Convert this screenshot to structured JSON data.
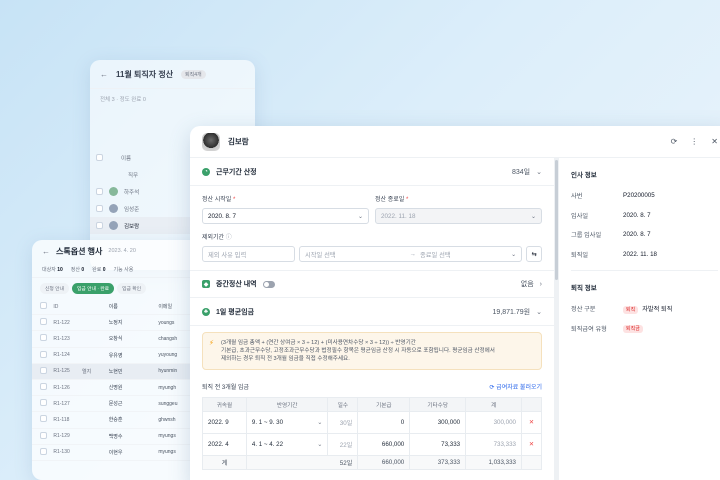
{
  "bg_panel_1": {
    "title": "11월 퇴직자 정산",
    "badge": "퇴직4개",
    "subtitle": "전체 3 · 정도 완료 0",
    "col_name": "이름",
    "col_role": "직무",
    "rows": [
      {
        "name": "하주석"
      },
      {
        "name": "임성준"
      },
      {
        "name": "김보람"
      }
    ]
  },
  "bg_panel_2": {
    "title": "스톡옵션 행사",
    "date": "2023. 4. 20",
    "stats": [
      {
        "label": "대상자",
        "value": "10"
      },
      {
        "label": "정산",
        "value": "0"
      },
      {
        "label": "완료",
        "value": "0"
      },
      {
        "label": "기능 사용",
        "value": ""
      }
    ],
    "chips": [
      "신청 안내",
      "입금 안내 · 완료",
      "입금 확인"
    ],
    "headers": [
      "ID",
      "이름",
      "이메일"
    ],
    "rows": [
      {
        "id": "R1-122",
        "tag": "",
        "name": "노정지",
        "email": "youngs"
      },
      {
        "id": "R1-123",
        "tag": "",
        "name": "오창식",
        "email": "changsh"
      },
      {
        "id": "R1-124",
        "tag": "",
        "name": "유유영",
        "email": "yuyoung"
      },
      {
        "id": "R1-125",
        "tag": "엘지",
        "name": "노현민",
        "email": "hyunmin"
      },
      {
        "id": "R1-126",
        "tag": "",
        "name": "신명원",
        "email": "myungh"
      },
      {
        "id": "R1-127",
        "tag": "",
        "name": "문성근",
        "email": "sunggeu"
      },
      {
        "id": "R1-118",
        "tag": "",
        "name": "한승훈",
        "email": "ghwnsh"
      },
      {
        "id": "R1-129",
        "tag": "",
        "name": "백명수",
        "email": "myungs"
      },
      {
        "id": "R1-130",
        "tag": "",
        "name": "이현우",
        "email": "myungs"
      }
    ]
  },
  "main": {
    "employee_name": "김보람",
    "service": {
      "title": "근무기간 산정",
      "value": "834일",
      "start_label": "정산 시작일",
      "start_value": "2020. 8. 7",
      "end_label": "정산 종료일",
      "end_value": "2022. 11. 18",
      "exclude_label": "제외기간",
      "reason_placeholder": "제외 사유 입력",
      "start_placeholder": "시작일 선택",
      "end_placeholder": "종료일 선택"
    },
    "interim": {
      "title": "중간정산 내역",
      "value": "없음"
    },
    "avg": {
      "title": "1일 평균임금",
      "value": "19,871.79원",
      "note_line1": "(3개월 임금 총액 + (연간 상여금 × 3 ÷ 12) + (미사용연차수당 × 3 ÷ 12)) ÷ 반영기간",
      "note_line2": "기본급, 초과근무수당, 고정조과근무수당과 법정필수 항목은 평균임금 산정 시 자동으로 포함됩니다. 평균임금 산정에서",
      "note_line3": "제외하는 경우 퇴직 전 3개월 임금을 직접 수정해주세요."
    },
    "wage": {
      "title": "퇴직 전 3개월 임금",
      "load_link": "급여자료 불러오기",
      "headers": [
        "귀속월",
        "반영기간",
        "일수",
        "기본급",
        "기타수당",
        "계"
      ],
      "rows": [
        {
          "month": "2022. 9",
          "period": "9. 1 ~ 9. 30",
          "days": "30일",
          "base": "0",
          "other": "300,000",
          "total": "300,000"
        },
        {
          "month": "2022. 4",
          "period": "4. 1 ~ 4. 22",
          "days": "22일",
          "base": "660,000",
          "other": "73,333",
          "total": "733,333"
        }
      ],
      "sum": {
        "label": "계",
        "days": "52일",
        "base": "660,000",
        "other": "373,333",
        "total": "1,033,333"
      }
    }
  },
  "right": {
    "hr_title": "인사 정보",
    "hr": [
      {
        "k": "사번",
        "v": "P20200005"
      },
      {
        "k": "입사일",
        "v": "2020. 8. 7"
      },
      {
        "k": "그룹 입사일",
        "v": "2020. 8. 7"
      },
      {
        "k": "퇴직일",
        "v": "2022. 11. 18"
      }
    ],
    "retire_title": "퇴직 정보",
    "settle_label": "정산 구분",
    "settle_tag": "퇴직",
    "settle_value": "자발적 퇴직",
    "pension_label": "퇴직급여 유형",
    "pension_tag": "퇴직금"
  },
  "colors": {
    "accent_green": "#3aa06a",
    "danger": "#ef4444",
    "link": "#2563eb"
  }
}
